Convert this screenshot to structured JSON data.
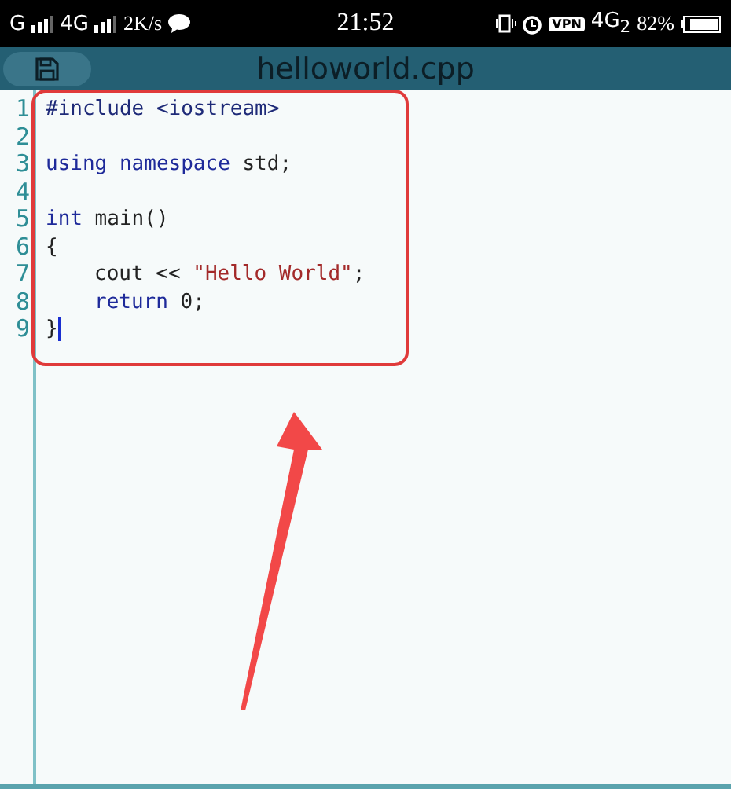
{
  "status_bar": {
    "network_1": "G",
    "network_2": "4G",
    "speed": "2K/s",
    "time": "21:52",
    "vpn": "VPN",
    "network_3": "4G$_{2}$",
    "battery": "82%"
  },
  "title_bar": {
    "title": "helloworld.cpp"
  },
  "editor": {
    "lines": [
      {
        "number": "1",
        "tokens": [
          {
            "kind": "preprocessor",
            "text": "#include <iostream>"
          }
        ]
      },
      {
        "number": "2"
      },
      {
        "number": "3",
        "tokens": [
          {
            "kind": "keyword",
            "text": "using namespace"
          },
          {
            "kind": "plain",
            "text": " std;"
          }
        ]
      },
      {
        "number": "4"
      },
      {
        "number": "5",
        "tokens": [
          {
            "kind": "keyword",
            "text": "int"
          },
          {
            "kind": "plain",
            "text": " main()"
          }
        ]
      },
      {
        "number": "6",
        "tokens": [
          {
            "kind": "plain",
            "text": "{"
          }
        ]
      },
      {
        "number": "7",
        "indented": true,
        "tokens": [
          {
            "kind": "plain",
            "text": "cout << "
          },
          {
            "kind": "string",
            "text": "\"Hello World\""
          },
          {
            "kind": "plain",
            "text": ";"
          }
        ]
      },
      {
        "number": "8",
        "indented": true,
        "tokens": [
          {
            "kind": "keyword",
            "text": "return"
          },
          {
            "kind": "plain",
            "text": " 0;"
          }
        ]
      },
      {
        "number": "9",
        "tokens": [
          {
            "kind": "plain",
            "text": "}"
          }
        ],
        "cursor": true
      }
    ]
  },
  "annotation": {
    "kind": "highlight-arrow"
  }
}
